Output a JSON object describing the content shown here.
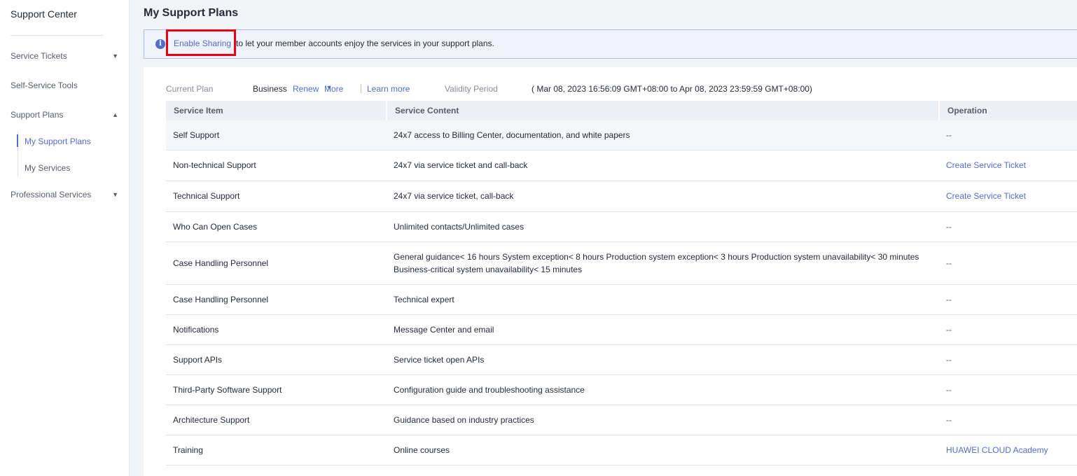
{
  "sidebar": {
    "title": "Support Center",
    "items": [
      {
        "label": "Service Tickets",
        "caret": "▼"
      },
      {
        "label": "Self-Service Tools"
      },
      {
        "label": "Support Plans",
        "caret": "▲"
      },
      {
        "label": "Professional Services",
        "caret": "▼"
      }
    ],
    "sub_items": [
      {
        "label": "My Support Plans",
        "active": true
      },
      {
        "label": "My Services"
      }
    ]
  },
  "page": {
    "title": "My Support Plans"
  },
  "banner": {
    "icon": "info-icon",
    "link_label": "Enable Sharing",
    "text": "to let your member accounts enjoy the services in your support plans."
  },
  "plan": {
    "current_plan_label": "Current Plan",
    "plan_name": "Business",
    "renew_label": "Renew",
    "more_label": "More",
    "learn_more_label": "Learn more",
    "validity_label": "Validity Period",
    "validity_value": "( Mar 08, 2023 16:56:09 GMT+08:00 to  Apr 08, 2023 23:59:59 GMT+08:00)"
  },
  "table": {
    "headers": [
      "Service Item",
      "Service Content",
      "Operation"
    ],
    "rows": [
      {
        "item": "Self Support",
        "content": "24x7 access to Billing Center, documentation, and white papers",
        "operation": "--"
      },
      {
        "item": "Non-technical Support",
        "content": "24x7 via service ticket and call-back",
        "operation": "Create Service Ticket"
      },
      {
        "item": "Technical Support",
        "content": "24x7 via service ticket, call-back",
        "operation": "Create Service Ticket"
      },
      {
        "item": "Who Can Open Cases",
        "content": "Unlimited contacts/Unlimited cases",
        "operation": "--"
      },
      {
        "item": "Case Handling Personnel",
        "content": "General guidance< 16 hours System exception< 8 hours Production system exception< 3 hours Production system unavailability< 30 minutes Business-critical system unavailability< 15 minutes",
        "operation": "--"
      },
      {
        "item": "Case Handling Personnel",
        "content": "Technical expert",
        "operation": "--"
      },
      {
        "item": "Notifications",
        "content": "Message Center and email",
        "operation": "--"
      },
      {
        "item": "Support APIs",
        "content": "Service ticket open APIs",
        "operation": "--"
      },
      {
        "item": "Third-Party Software Support",
        "content": "Configuration guide and troubleshooting assistance",
        "operation": "--"
      },
      {
        "item": "Architecture Support",
        "content": "Guidance based on industry practices",
        "operation": "--"
      },
      {
        "item": "Training",
        "content": "Online courses",
        "operation": "HUAWEI CLOUD Academy"
      }
    ]
  },
  "colors": {
    "accent": "#526ecc",
    "highlight": "#e60012"
  }
}
